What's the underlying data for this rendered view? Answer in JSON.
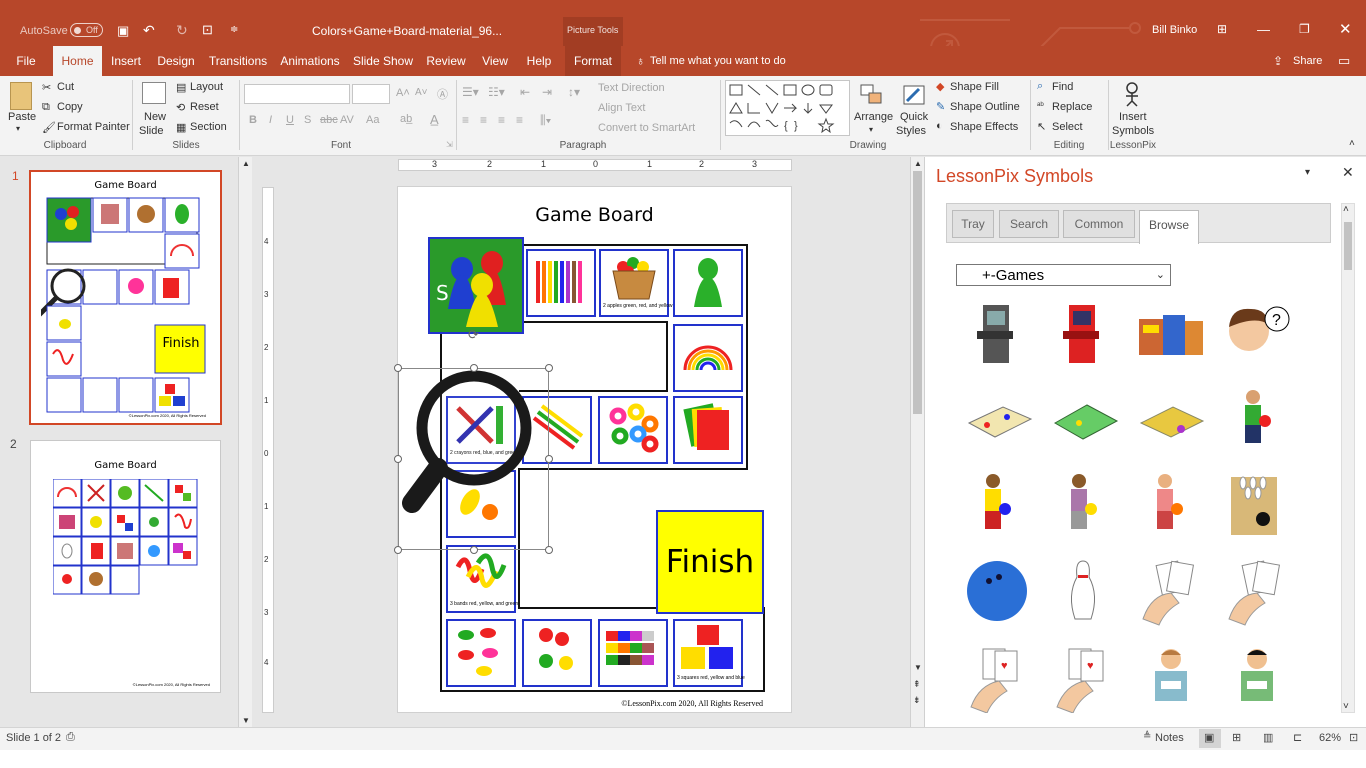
{
  "titlebar": {
    "autosave_label": "AutoSave",
    "autosave_state": "Off",
    "document_title": "Colors+Game+Board-material_96...",
    "context_group": "Picture Tools",
    "user_name": "Bill Binko"
  },
  "tabs": [
    "File",
    "Home",
    "Insert",
    "Design",
    "Transitions",
    "Animations",
    "Slide Show",
    "Review",
    "View",
    "Help",
    "Format"
  ],
  "tell_me": "Tell me what you want to do",
  "share_label": "Share",
  "ribbon": {
    "clipboard": {
      "paste": "Paste",
      "cut": "Cut",
      "copy": "Copy",
      "format_painter": "Format Painter",
      "group": "Clipboard"
    },
    "slides": {
      "new_slide_1": "New",
      "new_slide_2": "Slide",
      "layout": "Layout",
      "reset": "Reset",
      "section": "Section",
      "group": "Slides"
    },
    "font": {
      "bold": "B",
      "italic": "I",
      "underline": "U",
      "strike": "S",
      "abc": "abc",
      "av": "AV",
      "aa": "Aa",
      "group": "Font"
    },
    "paragraph": {
      "text_direction": "Text Direction",
      "align_text": "Align Text",
      "convert_smartart": "Convert to SmartArt",
      "group": "Paragraph"
    },
    "drawing": {
      "arrange": "Arrange",
      "quick_styles_1": "Quick",
      "quick_styles_2": "Styles",
      "shape_fill": "Shape Fill",
      "shape_outline": "Shape Outline",
      "shape_effects": "Shape Effects",
      "group": "Drawing"
    },
    "editing": {
      "find": "Find",
      "replace": "Replace",
      "select": "Select",
      "group": "Editing"
    },
    "lessonpix": {
      "insert_1": "Insert",
      "insert_2": "Symbols",
      "group": "LessonPix"
    }
  },
  "thumbnails": [
    {
      "number": "1",
      "title": "Game Board",
      "finish": "Finish",
      "footer": "©LessonPix.com 2020, All Rights Reserved"
    },
    {
      "number": "2",
      "title": "Game Board",
      "footer": "©LessonPix.com 2020, All Rights Reserved"
    }
  ],
  "ruler": {
    "h": [
      "3",
      "2",
      "1",
      "0",
      "1",
      "2",
      "3"
    ],
    "v": [
      "4",
      "3",
      "2",
      "1",
      "0",
      "1",
      "2",
      "3",
      "4"
    ]
  },
  "slide": {
    "title": "Game Board",
    "start_letter": "S",
    "finish": "Finish",
    "footer": "©LessonPix.com 2020, All Rights Reserved",
    "captions": {
      "apples": "2 apples green, red, and yellow",
      "crayons": "2 crayons red, blue, and green",
      "squares": "3 squares red, yellow and blue",
      "bands": "3 bands red, yellow, and green"
    }
  },
  "taskpane": {
    "title": "LessonPix Symbols",
    "tabs": [
      "Tray",
      "Search",
      "Common",
      "Browse"
    ],
    "active_tab": "Browse",
    "category": "+-Games"
  },
  "status": {
    "slide_of": "Slide 1 of 2",
    "notes": "Notes",
    "zoom": "62%"
  },
  "colors": {
    "accent": "#b7472a",
    "finish_yellow": "#ffff00",
    "cell_border": "#2233cc",
    "board_green": "#2a9a2a"
  }
}
